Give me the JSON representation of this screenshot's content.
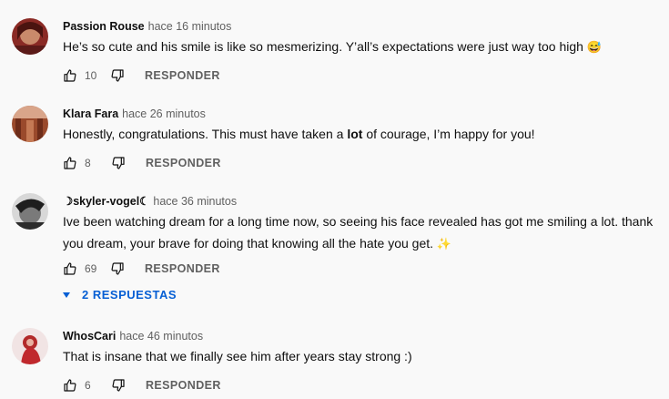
{
  "comments": [
    {
      "author": "Passion Rouse",
      "time": "hace 16 minutos",
      "text": "He’s so cute and his smile is like so mesmerizing. Y’all’s expectations were just way too high ",
      "emoji": "😅",
      "likes": "10",
      "reply_label": "RESPONDER",
      "avatar_color": "#6b1e1e"
    },
    {
      "author": "Klara Fara",
      "time": "hace 26 minutos",
      "text_before": "Honestly, congratulations. This must have taken a ",
      "text_bold": "lot",
      "text_after": " of courage, I’m happy for you!",
      "likes": "8",
      "reply_label": "RESPONDER",
      "avatar_color": "#b0603a"
    },
    {
      "author": "☽skyler-vogel☾",
      "time": "hace 36 minutos",
      "text": "Ive been watching dream for a long time now, so seeing his face revealed has got me smiling a lot. thank you dream, your brave for doing that knowing all the hate you get. ",
      "emoji": "✨",
      "likes": "69",
      "reply_label": "RESPONDER",
      "replies_label": "2 RESPUESTAS",
      "avatar_color": "#3a3a3a"
    },
    {
      "author": "WhosCari",
      "time": "hace 46 minutos",
      "text": "That is insane that we finally see him after years stay strong :)",
      "likes": "6",
      "reply_label": "RESPONDER",
      "avatar_color": "#c0282d"
    }
  ],
  "icons": {
    "like": "thumbs-up-icon",
    "dislike": "thumbs-down-icon",
    "expand": "caret-down-icon"
  },
  "colors": {
    "background": "#f9f9f9",
    "link_blue": "#065fd4",
    "secondary_text": "#606060"
  }
}
